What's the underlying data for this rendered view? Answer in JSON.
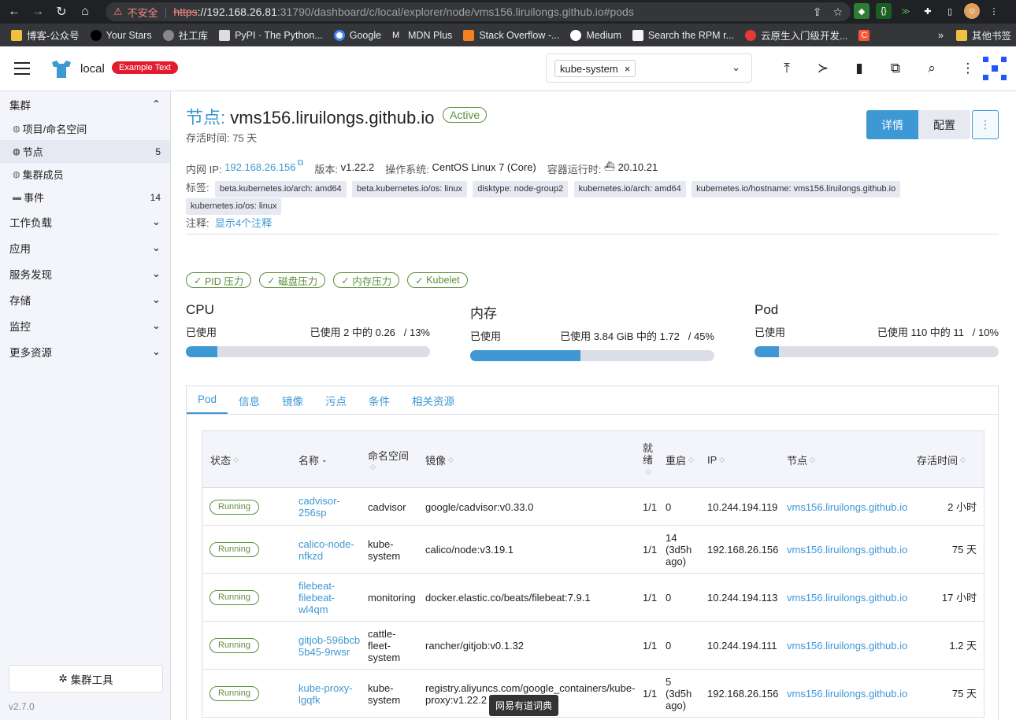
{
  "browser": {
    "url_warning": "不安全",
    "url_scheme": "https",
    "url_host": "://192.168.26.81",
    "url_rest": ":31790/dashboard/c/local/explorer/node/vms156.liruilongs.github.io#pods",
    "bookmarks": [
      "博客-公众号",
      "Your Stars",
      "社工库",
      "PyPI · The Python...",
      "Google",
      "MDN Plus",
      "Stack Overflow -...",
      "Medium",
      "Search the RPM r...",
      "云原生入门级开发..."
    ],
    "bookmarks_more": "»",
    "bookmarks_other": "其他书签"
  },
  "header": {
    "cluster": "local",
    "badge": "Example Text",
    "namespace": "kube-system",
    "namespace_remove": "×"
  },
  "sidebar": {
    "cluster_group": "集群",
    "items": [
      {
        "label": "项目/命名空间",
        "count": ""
      },
      {
        "label": "节点",
        "count": "5"
      },
      {
        "label": "集群成员",
        "count": ""
      },
      {
        "label": "事件",
        "count": "14"
      }
    ],
    "groups": [
      "工作负载",
      "应用",
      "服务发现",
      "存储",
      "监控",
      "更多资源"
    ],
    "tools": "集群工具",
    "version": "v2.7.0"
  },
  "node": {
    "title_prefix": "节点:",
    "name": "vms156.liruilongs.github.io",
    "state": "Active",
    "age": "存活时间: 75 天",
    "btn_detail": "详情",
    "btn_config": "配置",
    "btn_more": "⋮",
    "ip_label": "内网 IP:",
    "ip": "192.168.26.156",
    "version_label": "版本:",
    "version": "v1.22.2",
    "os_label": "操作系统:",
    "os": "CentOS Linux 7 (Core)",
    "runtime_label": "容器运行时:",
    "runtime": "20.10.21",
    "labels_label": "标签:",
    "labels": [
      "beta.kubernetes.io/arch: amd64",
      "beta.kubernetes.io/os: linux",
      "disktype: node-group2",
      "kubernetes.io/arch: amd64",
      "kubernetes.io/hostname: vms156.liruilongs.github.io",
      "kubernetes.io/os: linux"
    ],
    "notes_label": "注释:",
    "notes_link": "显示4个注释",
    "conditions": [
      "PID 压力",
      "磁盘压力",
      "内存压力",
      "Kubelet"
    ]
  },
  "gauges": [
    {
      "title": "CPU",
      "used_label": "已使用",
      "detail": "已使用 2 中的 0.26",
      "pct_text": "/ 13%",
      "pct": 13
    },
    {
      "title": "内存",
      "used_label": "已使用",
      "detail": "已使用 3.84 GiB 中的 1.72",
      "pct_text": "/ 45%",
      "pct": 45
    },
    {
      "title": "Pod",
      "used_label": "已使用",
      "detail": "已使用 110 中的 11",
      "pct_text": "/ 10%",
      "pct": 10
    }
  ],
  "tabs": [
    "Pod",
    "信息",
    "镜像",
    "污点",
    "条件",
    "相关资源"
  ],
  "table": {
    "headers": {
      "state": "状态",
      "name": "名称",
      "ns": "命名空间",
      "image": "镜像",
      "ready": "就绪",
      "restarts": "重启",
      "ip": "IP",
      "node": "节点",
      "age": "存活时间"
    },
    "rows": [
      {
        "state": "Running",
        "name": "cadvisor-256sp",
        "ns": "cadvisor",
        "image": "google/cadvisor:v0.33.0",
        "ready": "1/1",
        "restarts": "0",
        "ip": "10.244.194.119",
        "node": "vms156.liruilongs.github.io",
        "age": "2 小时"
      },
      {
        "state": "Running",
        "name": "calico-node-nfkzd",
        "ns": "kube-system",
        "image": "calico/node:v3.19.1",
        "ready": "1/1",
        "restarts": "14 (3d5h ago)",
        "ip": "192.168.26.156",
        "node": "vms156.liruilongs.github.io",
        "age": "75 天"
      },
      {
        "state": "Running",
        "name": "filebeat-filebeat-wl4qm",
        "ns": "monitoring",
        "image": "docker.elastic.co/beats/filebeat:7.9.1",
        "ready": "1/1",
        "restarts": "0",
        "ip": "10.244.194.113",
        "node": "vms156.liruilongs.github.io",
        "age": "17 小时"
      },
      {
        "state": "Running",
        "name": "gitjob-596bcb5b45-9rwsr",
        "ns": "cattle-fleet-system",
        "image": "rancher/gitjob:v0.1.32",
        "ready": "1/1",
        "restarts": "0",
        "ip": "10.244.194.111",
        "node": "vms156.liruilongs.github.io",
        "age": "1.2 天"
      },
      {
        "state": "Running",
        "name": "kube-proxy-lgqfk",
        "ns": "kube-system",
        "image": "registry.aliyuncs.com/google_containers/kube-proxy:v1.22.2",
        "ready": "1/1",
        "restarts": "5 (3d5h ago)",
        "ip": "192.168.26.156",
        "node": "vms156.liruilongs.github.io",
        "age": "75 天"
      }
    ]
  },
  "tooltip": "网易有道词典"
}
